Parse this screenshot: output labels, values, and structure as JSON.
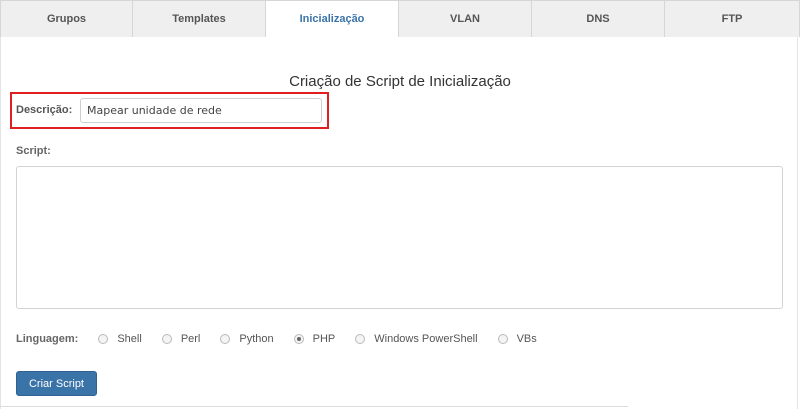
{
  "tabs": [
    {
      "label": "Grupos",
      "active": false
    },
    {
      "label": "Templates",
      "active": false
    },
    {
      "label": "Inicialização",
      "active": true
    },
    {
      "label": "VLAN",
      "active": false
    },
    {
      "label": "DNS",
      "active": false
    },
    {
      "label": "FTP",
      "active": false
    }
  ],
  "form": {
    "title": "Criação de Script de Inicialização",
    "description_label": "Descrição:",
    "description_value": "Mapear unidade de rede",
    "script_label": "Script:",
    "script_value": "",
    "language_label": "Linguagem:",
    "languages": [
      {
        "label": "Shell",
        "selected": false
      },
      {
        "label": "Perl",
        "selected": false
      },
      {
        "label": "Python",
        "selected": false
      },
      {
        "label": "PHP",
        "selected": true
      },
      {
        "label": "Windows PowerShell",
        "selected": false
      },
      {
        "label": "VBs",
        "selected": false
      }
    ],
    "submit_label": "Criar Script"
  },
  "colors": {
    "accent": "#3a73a8",
    "highlight_border": "#e02020"
  }
}
